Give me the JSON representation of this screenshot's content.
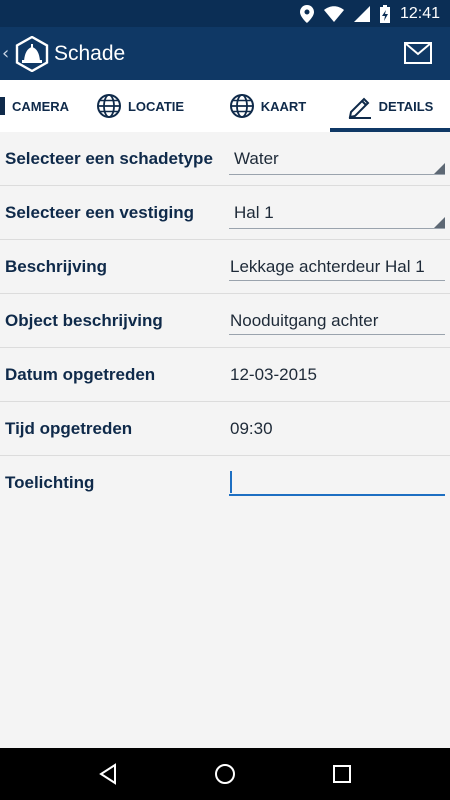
{
  "status_bar": {
    "time": "12:41"
  },
  "app_bar": {
    "title": "Schade",
    "back_icon": "chevron-left-icon",
    "logo_icon": "app-logo-icon",
    "action_icon": "mail-icon"
  },
  "tabs": [
    {
      "label": "CAMERA",
      "icon": "camera-icon",
      "active": false
    },
    {
      "label": "LOCATIE",
      "icon": "globe-icon",
      "active": false
    },
    {
      "label": "KAART",
      "icon": "globe-icon",
      "active": false
    },
    {
      "label": "DETAILS",
      "icon": "pencil-icon",
      "active": true
    }
  ],
  "form": {
    "schadetype": {
      "label": "Selecteer een schadetype",
      "value": "Water"
    },
    "vestiging": {
      "label": "Selecteer een vestiging",
      "value": "Hal 1"
    },
    "beschrijving": {
      "label": "Beschrijving",
      "value": "Lekkage achterdeur Hal 1"
    },
    "object": {
      "label": "Object beschrijving",
      "value": "Nooduitgang achter"
    },
    "datum": {
      "label": "Datum opgetreden",
      "value": "12-03-2015"
    },
    "tijd": {
      "label": "Tijd opgetreden",
      "value": "09:30"
    },
    "toelichting": {
      "label": "Toelichting",
      "value": ""
    }
  },
  "colors": {
    "primary": "#0f3865",
    "status_bar": "#0b2e55",
    "label_text": "#0f2a4a",
    "focus": "#1d6fc2"
  }
}
